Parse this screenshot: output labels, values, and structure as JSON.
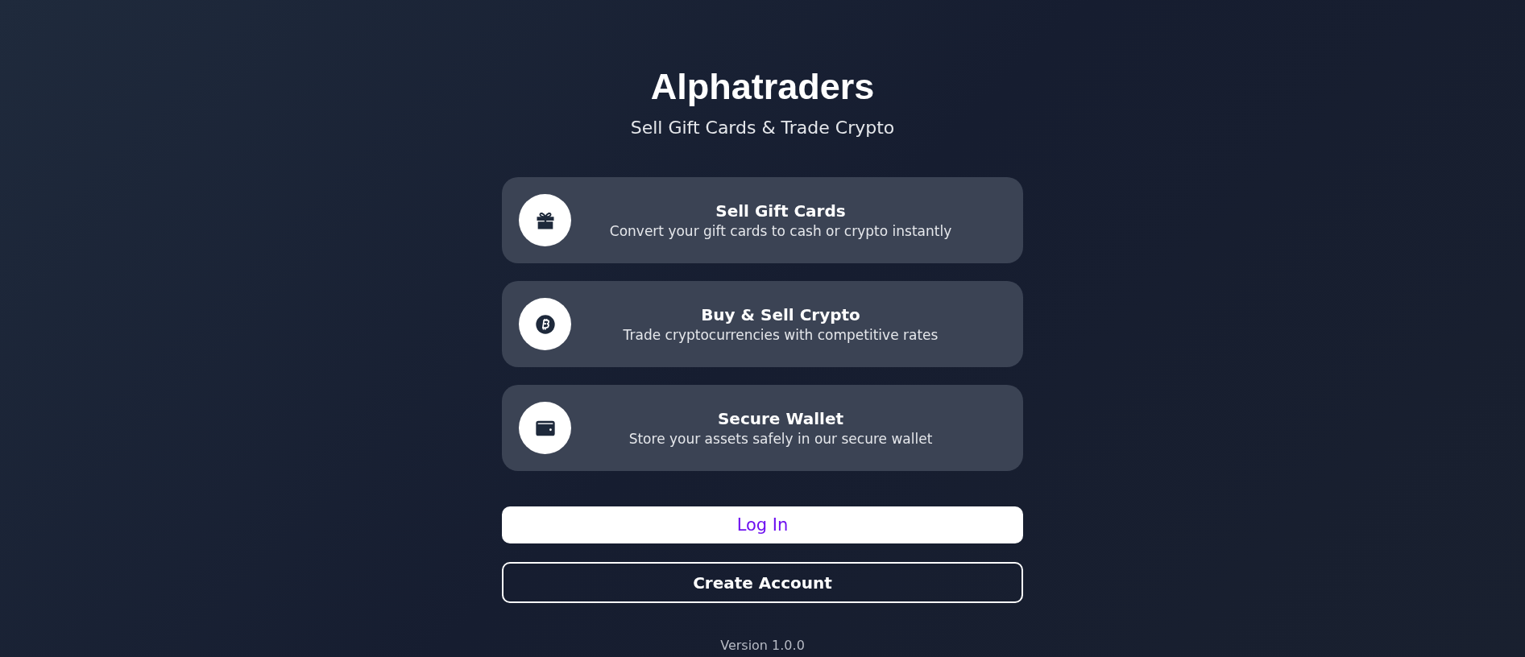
{
  "app": {
    "title": "Alphatraders",
    "subtitle": "Sell Gift Cards & Trade Crypto"
  },
  "features": [
    {
      "kind": "gift",
      "title": "Sell Gift Cards",
      "description": "Convert your gift cards to cash or crypto instantly"
    },
    {
      "kind": "bitcoin",
      "title": "Buy & Sell Crypto",
      "description": "Trade cryptocurrencies with competitive rates"
    },
    {
      "kind": "wallet",
      "title": "Secure Wallet",
      "description": "Store your assets safely in our secure wallet"
    }
  ],
  "buttons": [
    {
      "kind": "primary",
      "label": "Log In"
    },
    {
      "kind": "outline",
      "label": "Create Account"
    }
  ],
  "version": "Version 1.0.0"
}
